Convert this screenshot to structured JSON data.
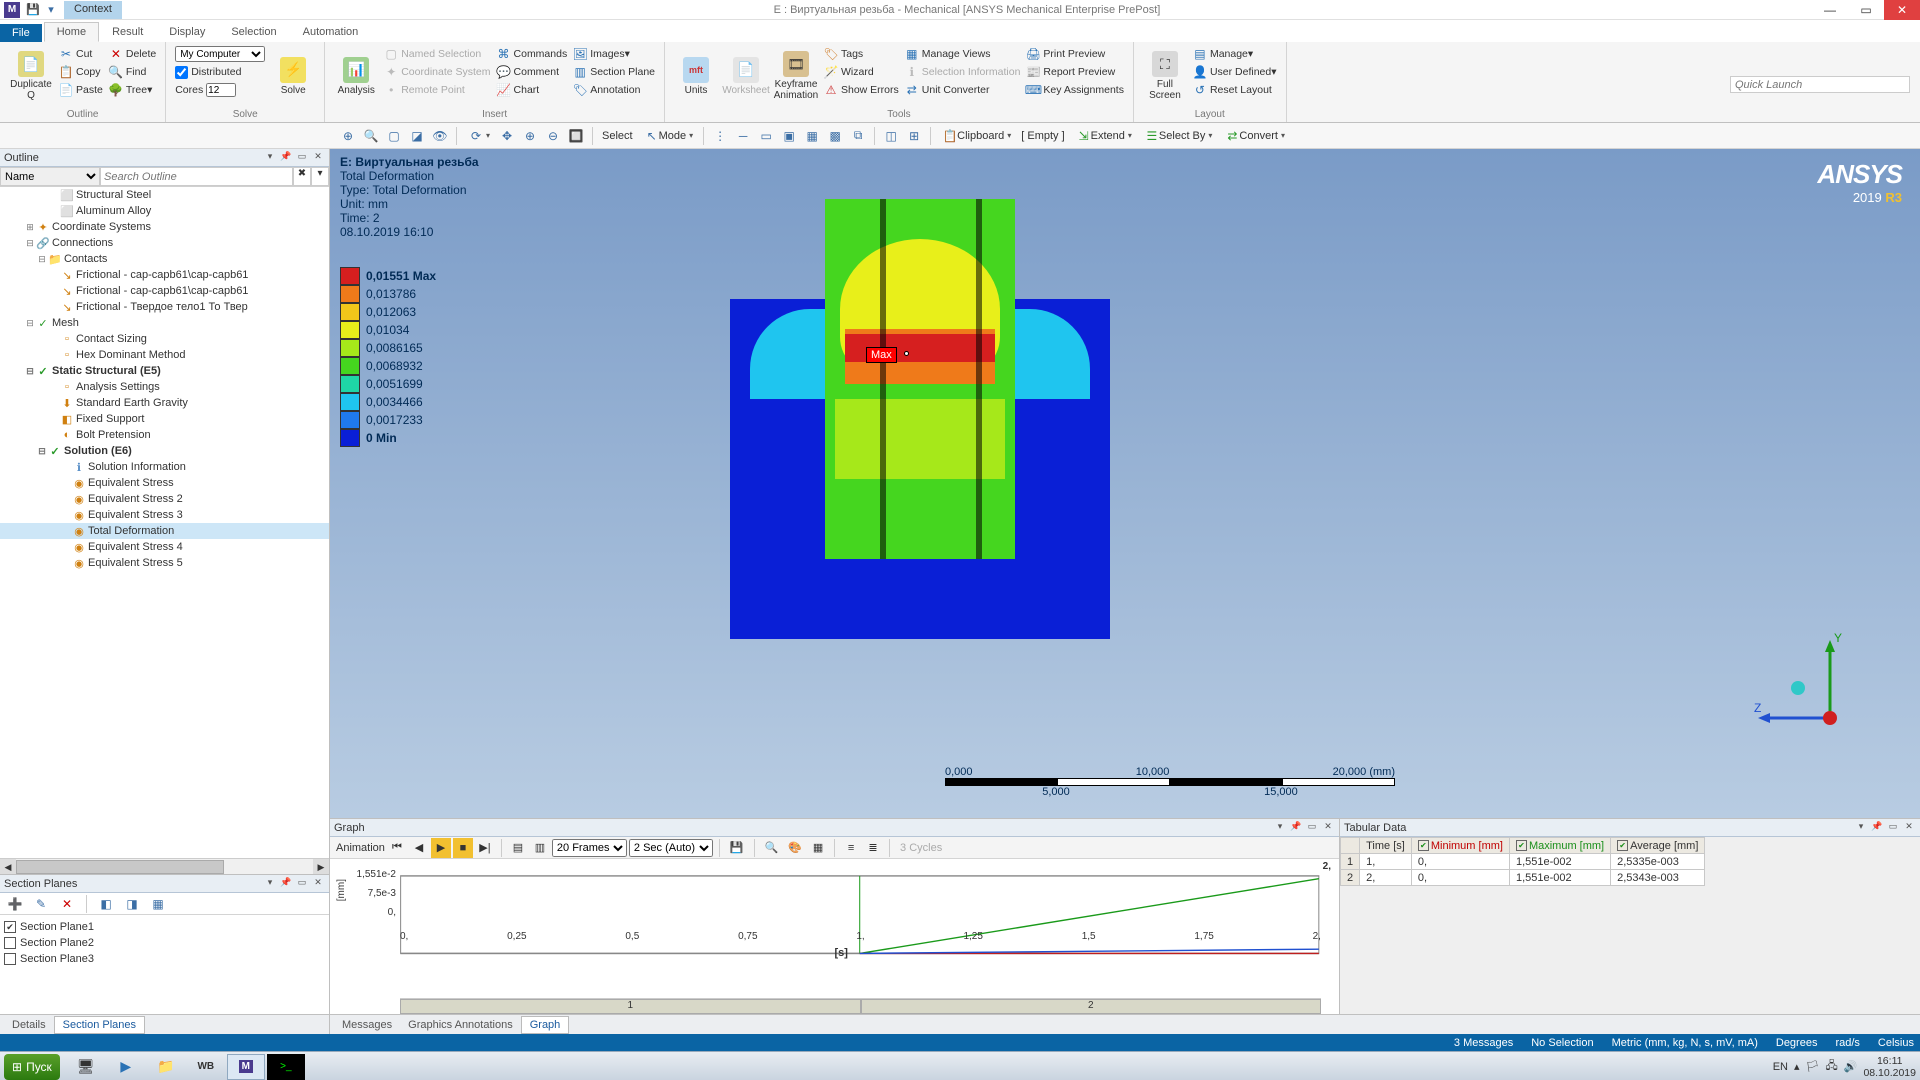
{
  "window": {
    "title": "E : Виртуальная резьба - Mechanical [ANSYS Mechanical Enterprise PrePost]",
    "app_initial": "M"
  },
  "ribbon": {
    "context_label": "Context",
    "file": "File",
    "tabs": [
      "Home",
      "Result",
      "Display",
      "Selection",
      "Automation"
    ],
    "active_tab": "Home",
    "quick_launch_placeholder": "Quick Launch",
    "groups": {
      "outline": "Outline",
      "solve": "Solve",
      "insert": "Insert",
      "tools": "Tools",
      "layout": "Layout"
    },
    "btn": {
      "duplicate": "Duplicate Q",
      "cut": "Cut",
      "copy": "Copy",
      "paste": "Paste",
      "delete": "Delete",
      "find": "Find",
      "tree": "Tree",
      "my_computer": "My Computer",
      "distributed": "Distributed",
      "cores_label": "Cores",
      "cores_value": "12",
      "solve": "Solve",
      "analysis": "Analysis",
      "named_sel": "Named Selection",
      "coord_sys": "Coordinate System",
      "remote_pt": "Remote Point",
      "commands": "Commands",
      "comment": "Comment",
      "chart": "Chart",
      "images": "Images",
      "section_plane": "Section Plane",
      "annotation": "Annotation",
      "units": "Units",
      "worksheet": "Worksheet",
      "keyframe": "Keyframe Animation",
      "tags": "Tags",
      "wizard": "Wizard",
      "show_errors": "Show Errors",
      "manage_views": "Manage Views",
      "sel_info": "Selection Information",
      "unit_conv": "Unit Converter",
      "print_preview": "Print Preview",
      "report_preview": "Report Preview",
      "key_assign": "Key Assignments",
      "full_screen": "Full Screen",
      "manage": "Manage",
      "user_defined": "User Defined",
      "reset_layout": "Reset Layout"
    }
  },
  "sectoolbar": {
    "select": "Select",
    "mode": "Mode",
    "clipboard": "Clipboard",
    "empty": "[ Empty ]",
    "extend": "Extend",
    "select_by": "Select By",
    "convert": "Convert"
  },
  "outline": {
    "title": "Outline",
    "name_label": "Name",
    "search_placeholder": "Search Outline",
    "items": [
      {
        "ind": 4,
        "tw": "",
        "ico": "⬜",
        "col": "#888",
        "label": "Structural Steel"
      },
      {
        "ind": 4,
        "tw": "",
        "ico": "⬜",
        "col": "#888",
        "label": "Aluminum Alloy"
      },
      {
        "ind": 2,
        "tw": "⊞",
        "ico": "✦",
        "col": "#d08010",
        "label": "Coordinate Systems"
      },
      {
        "ind": 2,
        "tw": "⊟",
        "ico": "🔗",
        "col": "#d08010",
        "label": "Connections"
      },
      {
        "ind": 3,
        "tw": "⊟",
        "ico": "📁",
        "col": "#d08010",
        "label": "Contacts"
      },
      {
        "ind": 4,
        "tw": "",
        "ico": "↘",
        "col": "#d08010",
        "label": "Frictional - cap-capb61\\cap-capb61"
      },
      {
        "ind": 4,
        "tw": "",
        "ico": "↘",
        "col": "#d08010",
        "label": "Frictional - cap-capb61\\cap-capb61"
      },
      {
        "ind": 4,
        "tw": "",
        "ico": "↘",
        "col": "#d08010",
        "label": "Frictional - Твердое тело1 То Твер"
      },
      {
        "ind": 2,
        "tw": "⊟",
        "ico": "✓",
        "col": "#2a9a2a",
        "label": "Mesh"
      },
      {
        "ind": 4,
        "tw": "",
        "ico": "▫",
        "col": "#d08010",
        "label": "Contact Sizing"
      },
      {
        "ind": 4,
        "tw": "",
        "ico": "▫",
        "col": "#d08010",
        "label": "Hex Dominant Method"
      },
      {
        "ind": 2,
        "tw": "⊟",
        "ico": "✓",
        "col": "#2a9a2a",
        "label": "Static Structural (E5)",
        "bold": true
      },
      {
        "ind": 4,
        "tw": "",
        "ico": "▫",
        "col": "#d08010",
        "label": "Analysis Settings"
      },
      {
        "ind": 4,
        "tw": "",
        "ico": "⬇",
        "col": "#d08010",
        "label": "Standard Earth Gravity"
      },
      {
        "ind": 4,
        "tw": "",
        "ico": "◧",
        "col": "#d08010",
        "label": "Fixed Support"
      },
      {
        "ind": 4,
        "tw": "",
        "ico": "◐",
        "col": "#d08010",
        "label": "Bolt Pretension"
      },
      {
        "ind": 3,
        "tw": "⊟",
        "ico": "✓",
        "col": "#2a9a2a",
        "label": "Solution (E6)",
        "bold": true
      },
      {
        "ind": 5,
        "tw": "",
        "ico": "ℹ",
        "col": "#5a90c8",
        "label": "Solution Information"
      },
      {
        "ind": 5,
        "tw": "",
        "ico": "◉",
        "col": "#d08010",
        "label": "Equivalent Stress"
      },
      {
        "ind": 5,
        "tw": "",
        "ico": "◉",
        "col": "#d08010",
        "label": "Equivalent Stress 2"
      },
      {
        "ind": 5,
        "tw": "",
        "ico": "◉",
        "col": "#d08010",
        "label": "Equivalent Stress 3"
      },
      {
        "ind": 5,
        "tw": "",
        "ico": "◉",
        "col": "#d08010",
        "label": "Total Deformation",
        "sel": true
      },
      {
        "ind": 5,
        "tw": "",
        "ico": "◉",
        "col": "#d08010",
        "label": "Equivalent Stress 4"
      },
      {
        "ind": 5,
        "tw": "",
        "ico": "◉",
        "col": "#d08010",
        "label": "Equivalent Stress 5"
      }
    ]
  },
  "section_planes": {
    "title": "Section Planes",
    "items": [
      {
        "checked": true,
        "label": "Section Plane1"
      },
      {
        "checked": false,
        "label": "Section Plane2"
      },
      {
        "checked": false,
        "label": "Section Plane3"
      }
    ]
  },
  "result": {
    "header": "E: Виртуальная резьба",
    "name": "Total Deformation",
    "type": "Type: Total Deformation",
    "unit": "Unit: mm",
    "time": "Time: 2",
    "stamp": "08.10.2019 16:10",
    "max_marker": "Max",
    "legend": [
      {
        "c": "#d61f1f",
        "v": "0,01551 Max",
        "bold": true
      },
      {
        "c": "#ef7a1a",
        "v": "0,013786"
      },
      {
        "c": "#f2c71a",
        "v": "0,012063"
      },
      {
        "c": "#e8ef1a",
        "v": "0,01034"
      },
      {
        "c": "#a6e81a",
        "v": "0,0086165"
      },
      {
        "c": "#45d61f",
        "v": "0,0068932"
      },
      {
        "c": "#1fd6a6",
        "v": "0,0051699"
      },
      {
        "c": "#1fc5ef",
        "v": "0,0034466"
      },
      {
        "c": "#1f7aef",
        "v": "0,0017233"
      },
      {
        "c": "#0a1fd6",
        "v": "0 Min",
        "bold": true
      }
    ],
    "scale_top": [
      "0,000",
      "10,000",
      "20,000 (mm)"
    ],
    "scale_bot": [
      "5,000",
      "15,000"
    ]
  },
  "ansys": {
    "brand": "ANSYS",
    "year": "2019 ",
    "rel": "R3"
  },
  "graph_panel": {
    "title": "Graph",
    "anim_label": "Animation",
    "frames_sel": "20 Frames",
    "secs_sel": "2 Sec (Auto)",
    "cycles": "3 Cycles",
    "y_ticks": [
      "1,551e-2",
      "7,5e-3",
      "0,"
    ],
    "x_ticks": [
      "0,",
      "0,25",
      "0,5",
      "0,75",
      "1,",
      "1,25",
      "1,5",
      "1,75",
      "2,"
    ],
    "y_unit": "[mm]",
    "x_unit": "[s]",
    "slider_marks": [
      "1",
      "2"
    ],
    "corner_val": "2,"
  },
  "tabular": {
    "title": "Tabular Data",
    "cols": [
      "Time [s]",
      "Minimum [mm]",
      "Maximum [mm]",
      "Average [mm]"
    ],
    "rows": [
      {
        "n": "1",
        "t": "1,",
        "min": "0,",
        "max": "1,551e-002",
        "avg": "2,5335e-003"
      },
      {
        "n": "2",
        "t": "2,",
        "min": "0,",
        "max": "1,551e-002",
        "avg": "2,5343e-003"
      }
    ]
  },
  "bottom_tabs_left": [
    "Details",
    "Section Planes"
  ],
  "bottom_tabs_center": [
    "Messages",
    "Graphics Annotations",
    "Graph"
  ],
  "status": {
    "messages": "3 Messages",
    "selection": "No Selection",
    "units": "Metric (mm, kg, N, s, mV, mA)",
    "angle": "Degrees",
    "angvel": "rad/s",
    "temp": "Celsius"
  },
  "taskbar": {
    "start": "Пуск",
    "lang": "EN",
    "time": "16:11",
    "date": "08.10.2019"
  }
}
